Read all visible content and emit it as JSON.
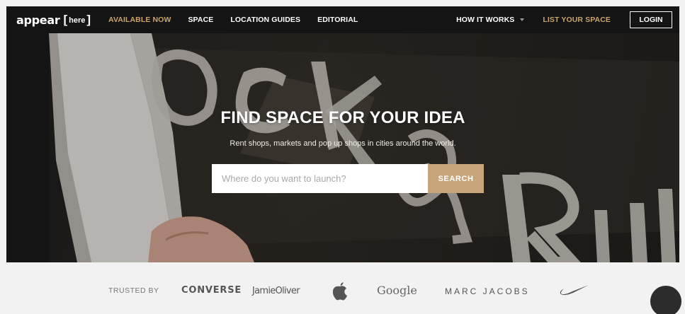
{
  "logo": {
    "word": "appear",
    "bracket_open": "[",
    "here": "here",
    "bracket_close": "]"
  },
  "nav": {
    "left_items": [
      {
        "label": "AVAILABLE NOW",
        "accent": true
      },
      {
        "label": "SPACE"
      },
      {
        "label": "LOCATION GUIDES"
      },
      {
        "label": "EDITORIAL"
      }
    ],
    "how_it_works": "HOW IT WORKS",
    "list_space": "LIST YOUR SPACE",
    "login": "LOGIN"
  },
  "hero": {
    "title": "FIND SPACE FOR YOUR IDEA",
    "subtitle": "Rent shops, markets and pop up shops in cities around the world.",
    "search_placeholder": "Where do you want to launch?",
    "search_button": "SEARCH"
  },
  "trusted": {
    "label": "TRUSTED BY",
    "brands": {
      "converse": "CONVERSE",
      "jamie": "JamieOliver",
      "google": "Google",
      "marc": "MARC JACOBS"
    }
  },
  "colors": {
    "accent": "#c9a46e",
    "search_button": "#c8a47a",
    "nav_bg": "#141414"
  }
}
